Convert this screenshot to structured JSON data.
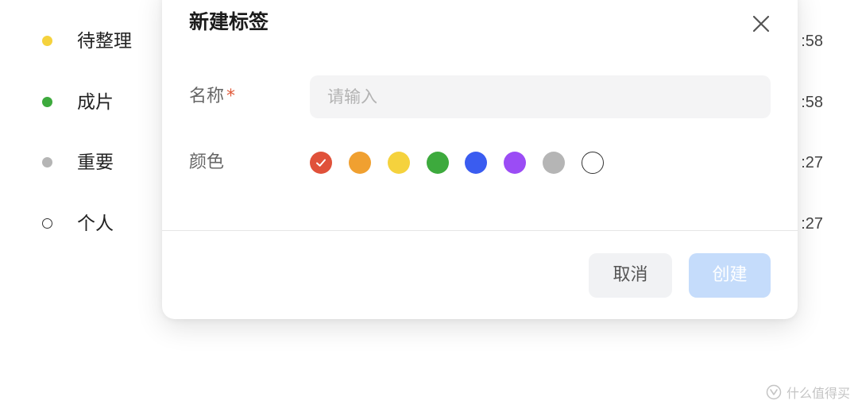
{
  "background_list": {
    "items": [
      {
        "label": "待整理",
        "time": ":58",
        "dot_color": "#f5d23d",
        "dot_style": "filled"
      },
      {
        "label": "成片",
        "time": ":58",
        "dot_color": "#3daa3d",
        "dot_style": "filled"
      },
      {
        "label": "重要",
        "time": ":27",
        "dot_color": "#b5b5b5",
        "dot_style": "filled"
      },
      {
        "label": "个人",
        "time": ":27",
        "dot_color": "#333333",
        "dot_style": "outline"
      }
    ]
  },
  "dialog": {
    "title": "新建标签",
    "close_icon": "close-icon",
    "name_field": {
      "label": "名称",
      "required_mark": "*",
      "placeholder": "请输入",
      "value": ""
    },
    "color_field": {
      "label": "颜色",
      "selected_index": 0,
      "options": [
        {
          "name": "red",
          "hex": "#e0513a"
        },
        {
          "name": "orange",
          "hex": "#f0a030"
        },
        {
          "name": "yellow",
          "hex": "#f5d23d"
        },
        {
          "name": "green",
          "hex": "#3daa3d"
        },
        {
          "name": "blue",
          "hex": "#3a5cf0"
        },
        {
          "name": "purple",
          "hex": "#9b4cf5"
        },
        {
          "name": "gray",
          "hex": "#b5b5b5"
        },
        {
          "name": "white",
          "hex": "#ffffff"
        }
      ]
    },
    "buttons": {
      "cancel_label": "取消",
      "create_label": "创建",
      "create_enabled": false
    }
  },
  "watermark": {
    "text": "什么值得买",
    "logo_icon": "smzdm-logo-icon"
  }
}
